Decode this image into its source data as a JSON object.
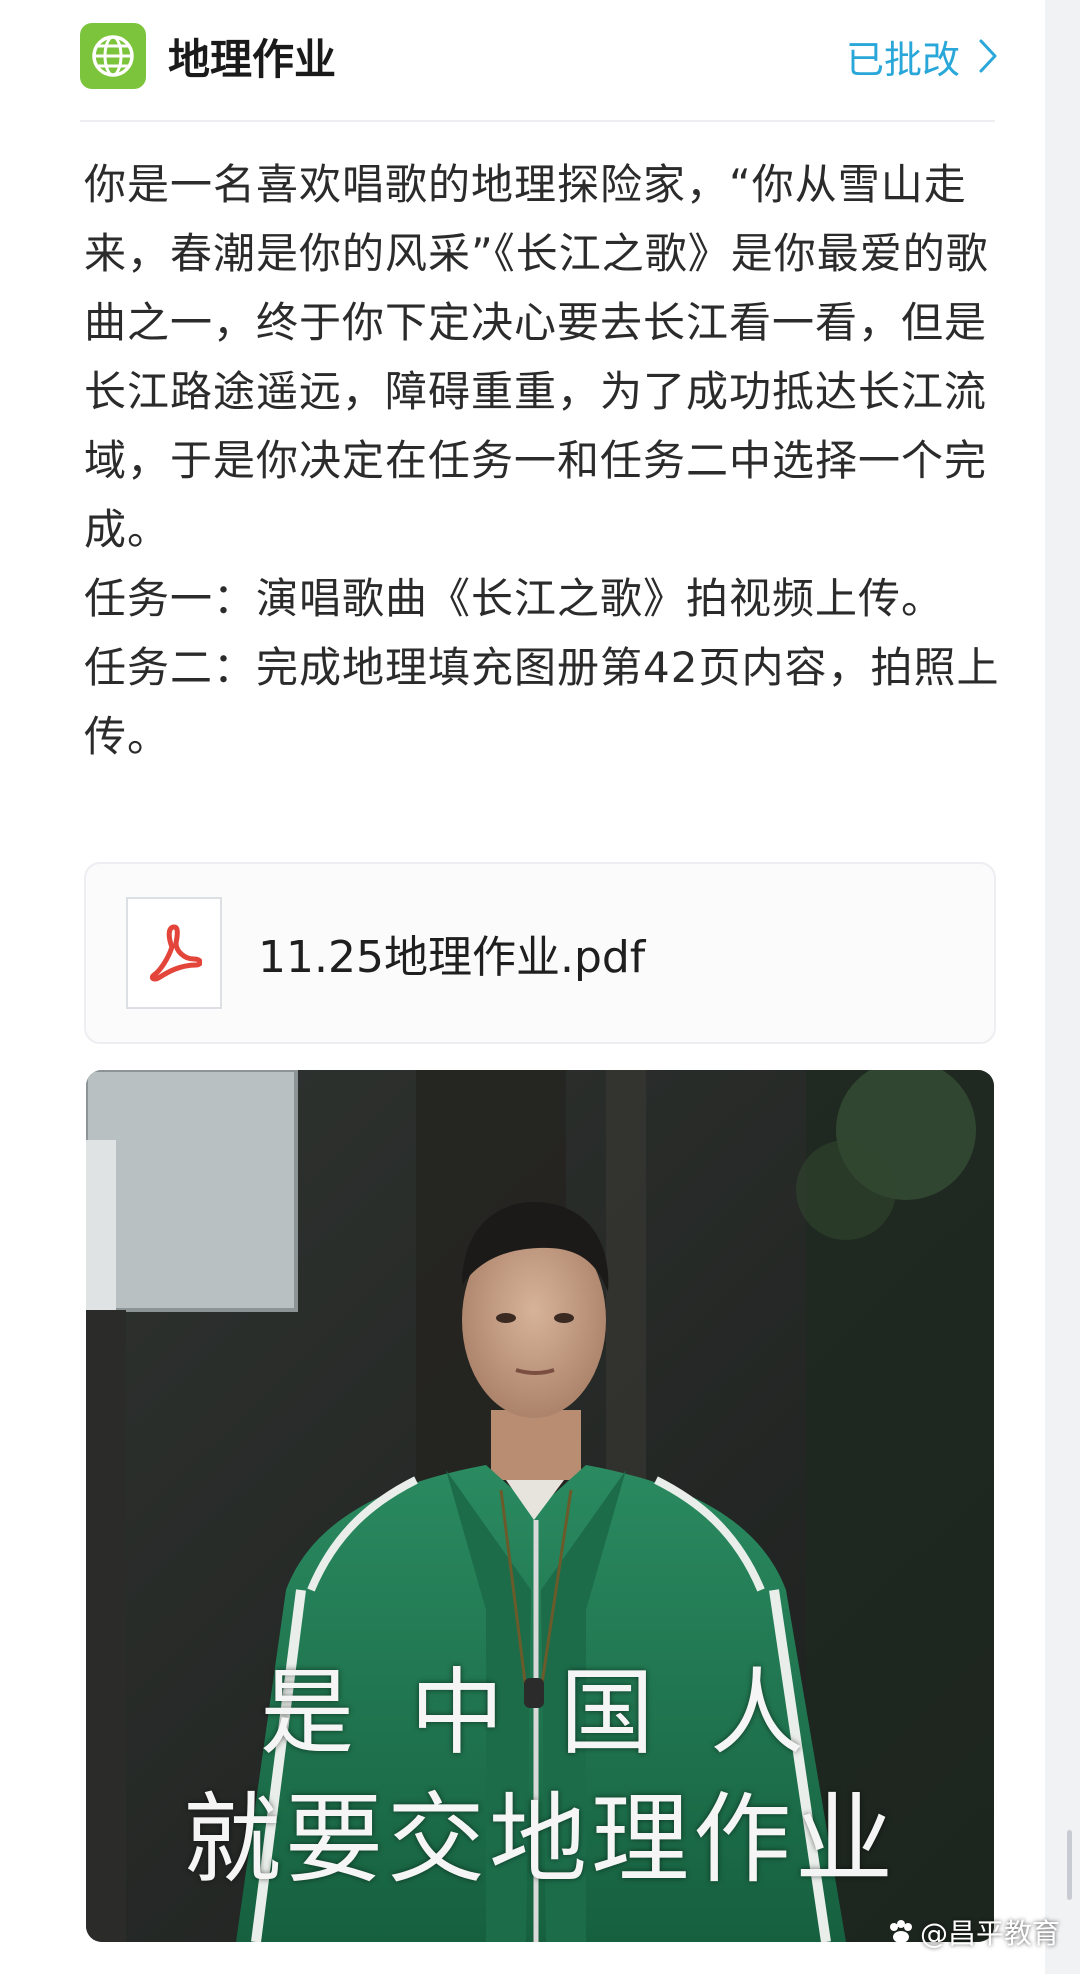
{
  "header": {
    "subject_title": "地理作业",
    "status_label": "已批改"
  },
  "content": {
    "paragraphs": [
      "你是一名喜欢唱歌的地理探险家，“你从雪山走来，春潮是你的风采”《长江之歌》是你最爱的歌曲之一，终于你下定决心要去长江看一看，但是长江路途遥远，障碍重重，为了成功抵达长江流域，于是你决定在任务一和任务二中选择一个完成。",
      "任务一：演唱歌曲《长江之歌》拍视频上传。",
      "任务二：完成地理填充图册第42页内容，拍照上传。"
    ]
  },
  "attachment": {
    "file_name": "11.25地理作业.pdf",
    "icon": "pdf-icon"
  },
  "meme": {
    "caption_line1": "是中国人",
    "caption_line2": "就要交地理作业"
  },
  "watermark": {
    "text": "@昌平教育"
  },
  "colors": {
    "accent": "#2aa7d9",
    "subject_icon_bg": "#7cc43b",
    "pdf_red": "#e3453a",
    "jacket_green": "#1f7a55"
  }
}
